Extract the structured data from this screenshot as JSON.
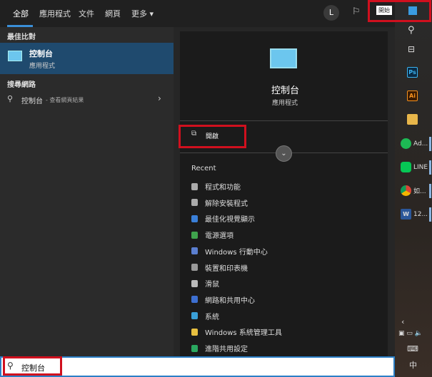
{
  "tabs": [
    "全部",
    "應用程式",
    "文件",
    "網頁",
    "更多 ▾"
  ],
  "avatar": "L",
  "start_tooltip": "開始",
  "left": {
    "best_match": "最佳比對",
    "app_name": "控制台",
    "app_type": "應用程式",
    "web_section": "搜尋網路",
    "web_query": "控制台",
    "web_suffix": " - 查看網頁結果"
  },
  "detail": {
    "name": "控制台",
    "type": "應用程式",
    "open": "開啟",
    "recent_title": "Recent",
    "recent": [
      "程式和功能",
      "解除安裝程式",
      "最佳化視覺顯示",
      "電源選項",
      "Windows 行動中心",
      "裝置和印表機",
      "滑鼠",
      "網路和共用中心",
      "系統",
      "Windows 系統管理工具",
      "進階共用設定"
    ]
  },
  "taskbar": {
    "ad": "Ad...",
    "line": "LINE",
    "chrome": "如...",
    "word": "12...",
    "ime": "中",
    "ps": "Ps",
    "ai": "Ai"
  },
  "search": {
    "value": "控制台"
  },
  "colors": {
    "highlight": "#d0101e",
    "accent": "#3a8fd8",
    "selected": "#1f4a6e"
  }
}
